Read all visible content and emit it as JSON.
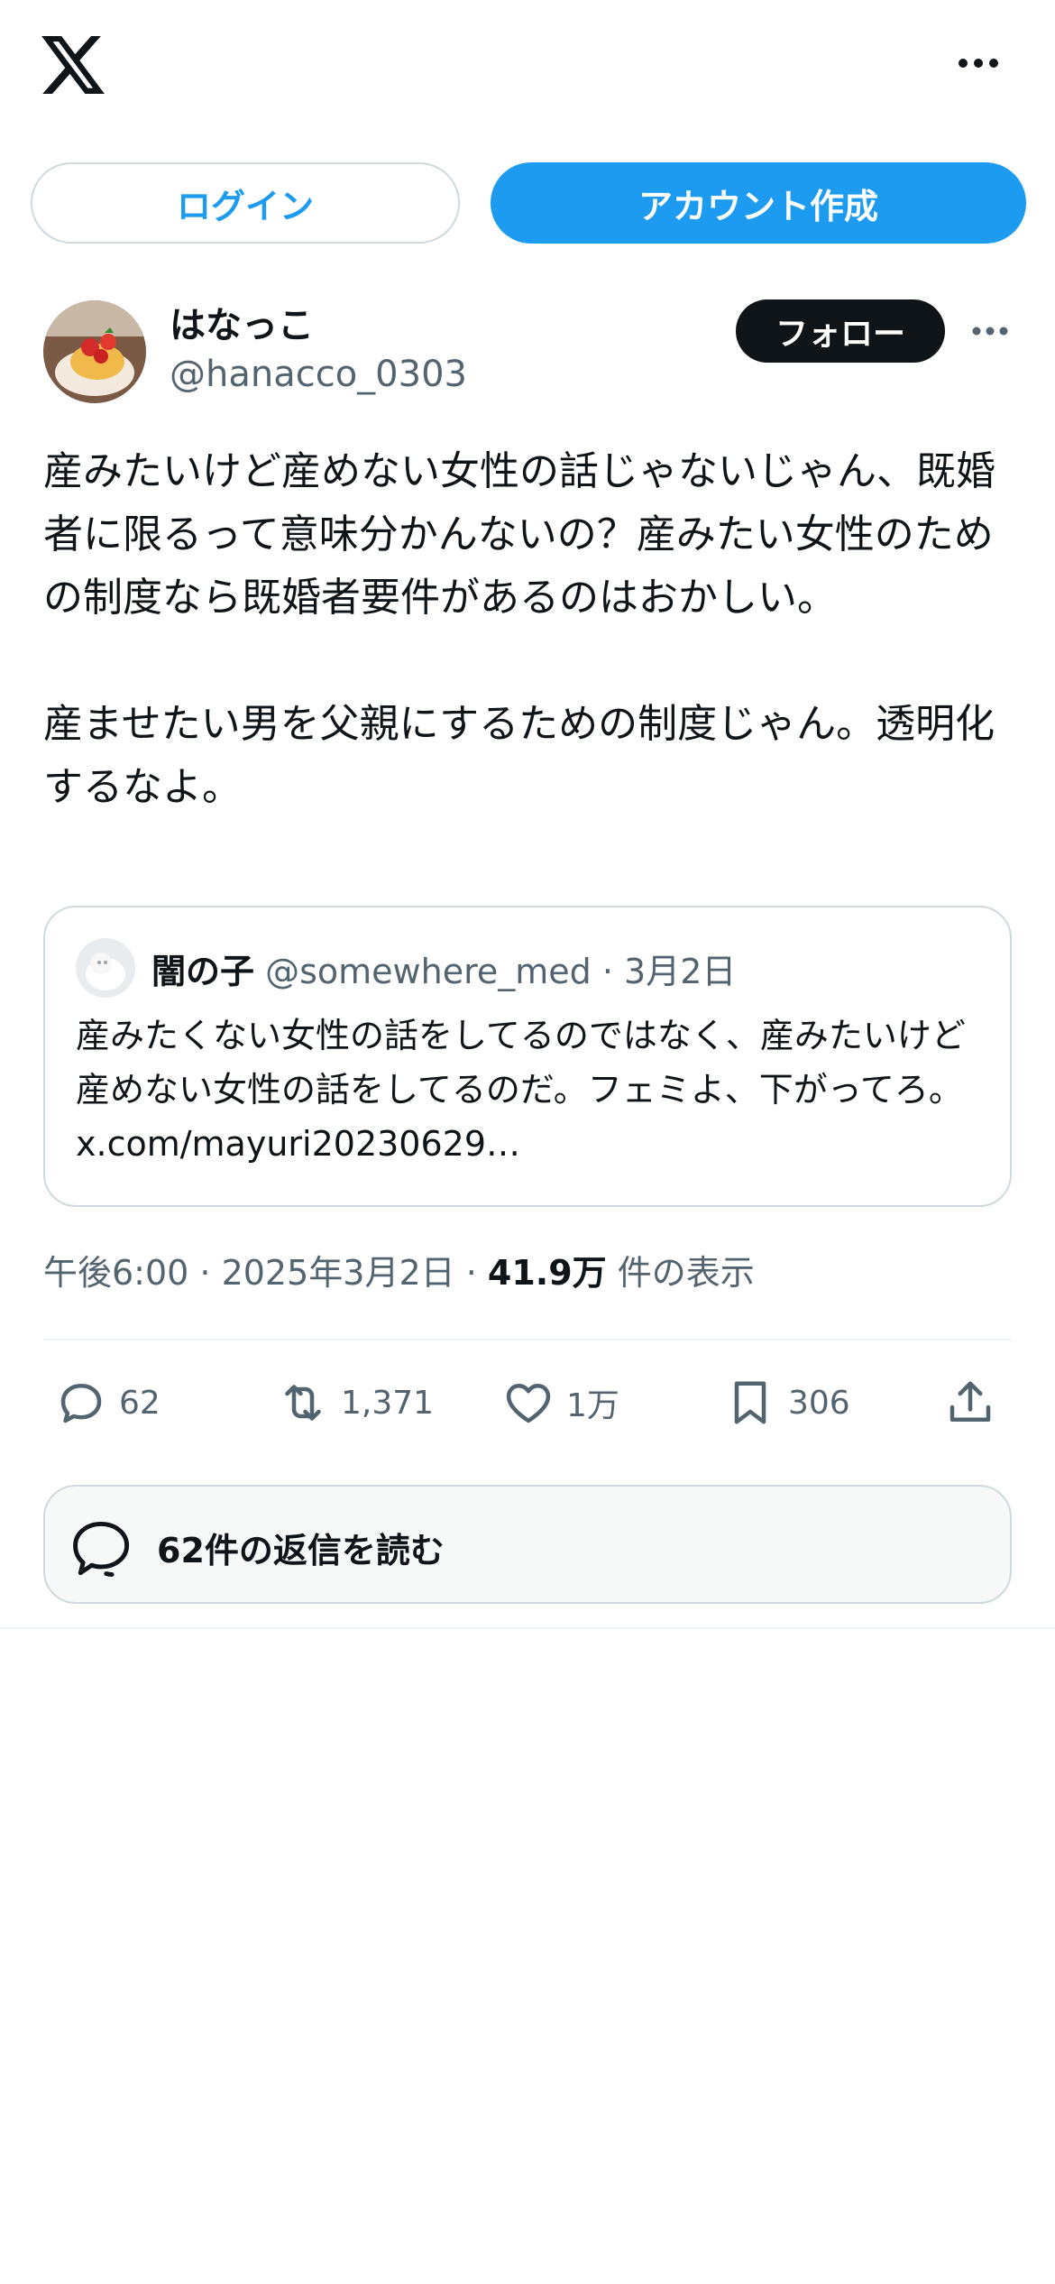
{
  "header": {
    "logo_icon": "x-logo-icon",
    "more_icon": "more-horizontal-icon"
  },
  "auth": {
    "login_label": "ログイン",
    "signup_label": "アカウント作成"
  },
  "tweet": {
    "author_name": "はなっこ",
    "author_handle": "@hanacco_0303",
    "follow_label": "フォロー",
    "text": "産みたいけど産めない女性の話じゃないじゃん、既婚者に限るって意味分かんないの？産みたい女性のための制度なら既婚者要件があるのはおかしい。\n\n産ませたい男を父親にするための制度じゃん。透明化するなよ。",
    "quote": {
      "name": "闇の子",
      "handle_date": "@somewhere_med · 3月2日",
      "text": "産みたくない女性の話をしてるのではなく、産みたいけど産めない女性の話をしてるのだ。フェミよ、下がってろ。 x.com/mayuri20230629…"
    },
    "meta_time": "午後6:00 · 2025年3月2日 · ",
    "meta_views": "41.9万",
    "meta_views_suffix": " 件の表示",
    "actions": {
      "replies": "62",
      "retweets": "1,371",
      "likes": "1万",
      "bookmarks": "306"
    },
    "read_replies_label": "62件の返信を読む"
  },
  "colors": {
    "accent": "#1d9bf0",
    "text": "#0f1419",
    "muted": "#536471",
    "border": "#cfd9de"
  }
}
